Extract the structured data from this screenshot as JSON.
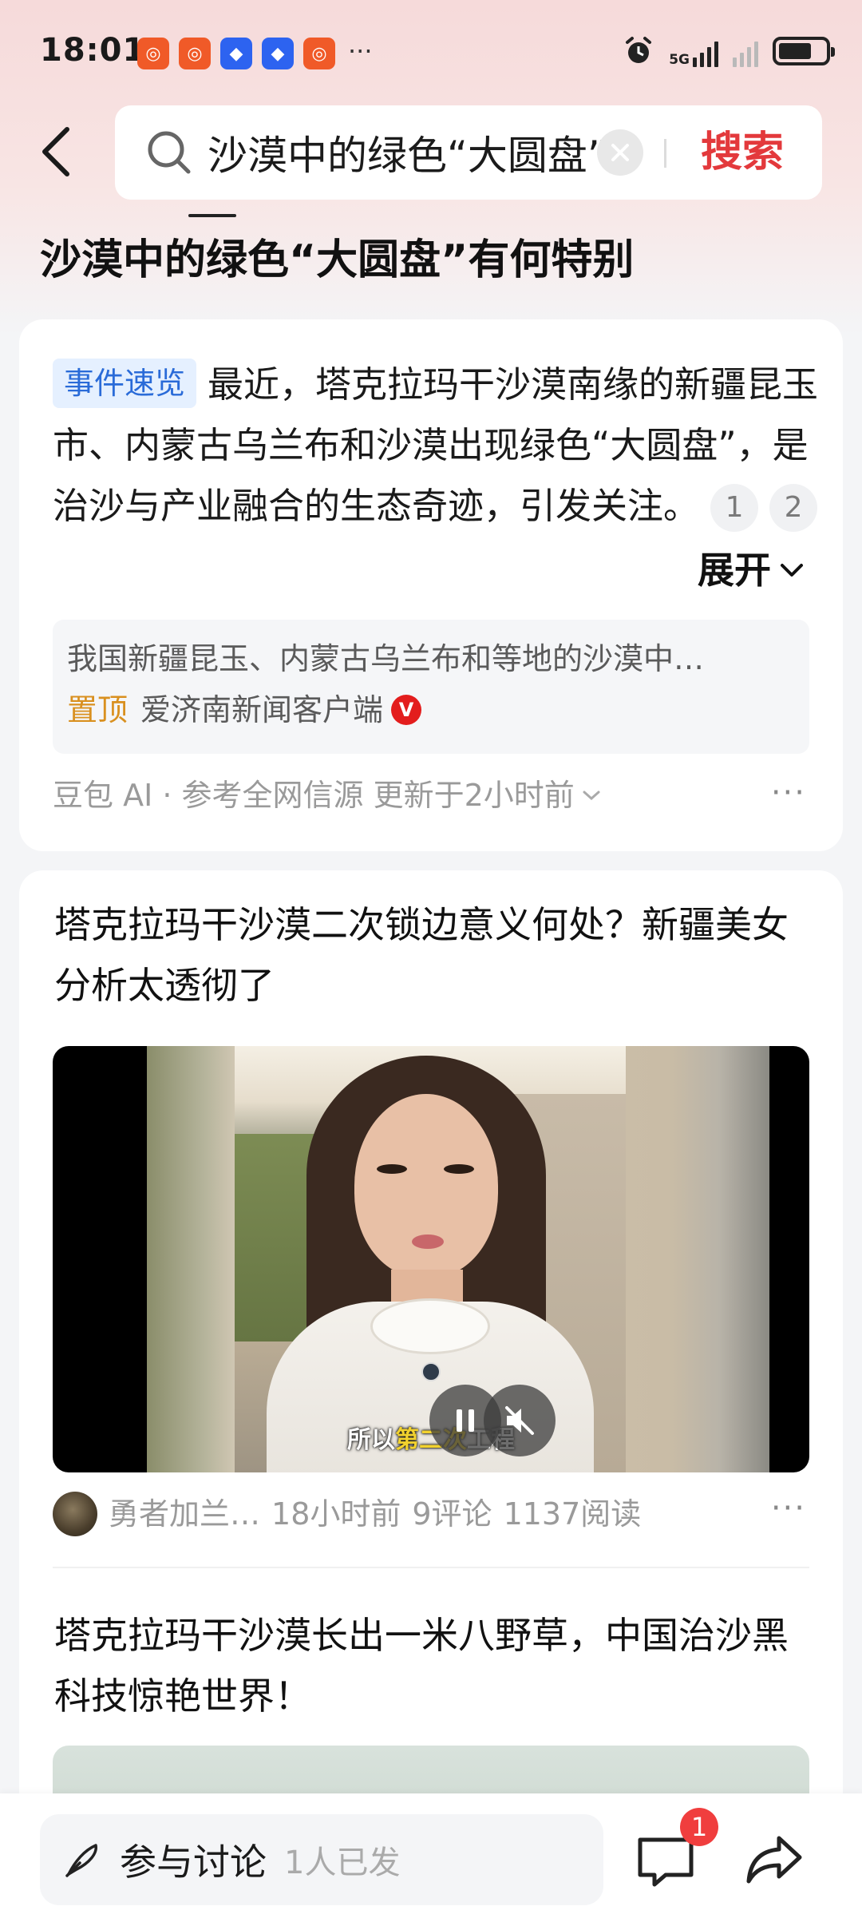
{
  "status_bar": {
    "time": "18:01",
    "more_indicator": "···",
    "network_label": "5G",
    "notification_icons": [
      "app-orange-icon",
      "app-orange-icon",
      "app-blue-icon",
      "app-blue-icon",
      "app-orange-icon"
    ]
  },
  "search": {
    "query": "沙漠中的绿色“大圆盘”有何特别",
    "submit_label": "搜索"
  },
  "page_title": "沙漠中的绿色“大圆盘”有何特别",
  "summary": {
    "tag": "事件速览",
    "text": "最近，塔克拉玛干沙漠南缘的新疆昆玉市、内蒙古乌兰布和沙漠出现绿色“大圆盘”，是治沙与产业融合的生态奇迹，引发关注。",
    "refs": [
      "1",
      "2"
    ],
    "expand_label": "展开",
    "source_snippet": "我国新疆昆玉、内蒙古乌兰布和等地的沙漠中…",
    "source_pin": "置顶",
    "source_name": "爱济南新闻客户端",
    "verified_mark": "V",
    "meta": "豆包 AI · 参考全网信源 更新于2小时前"
  },
  "articles": [
    {
      "title": "塔克拉玛干沙漠二次锁边意义何处？新疆美女分析太透彻了",
      "subtitle_pre": "所以",
      "subtitle_hl": "第二次",
      "subtitle_post": "工程",
      "author": "勇者加兰…",
      "time": "18小时前",
      "comments": "9评论",
      "reads": "1137阅读"
    },
    {
      "title": "塔克拉玛干沙漠长出一米八野草，中国治沙黑科技惊艳世界！"
    }
  ],
  "bottom_bar": {
    "discuss_label": "参与讨论",
    "discuss_count": "1人已发",
    "comment_badge": "1"
  },
  "colors": {
    "accent_red": "#e3393c",
    "tag_blue": "#2a6bd8",
    "pin_orange": "#d9901f"
  }
}
